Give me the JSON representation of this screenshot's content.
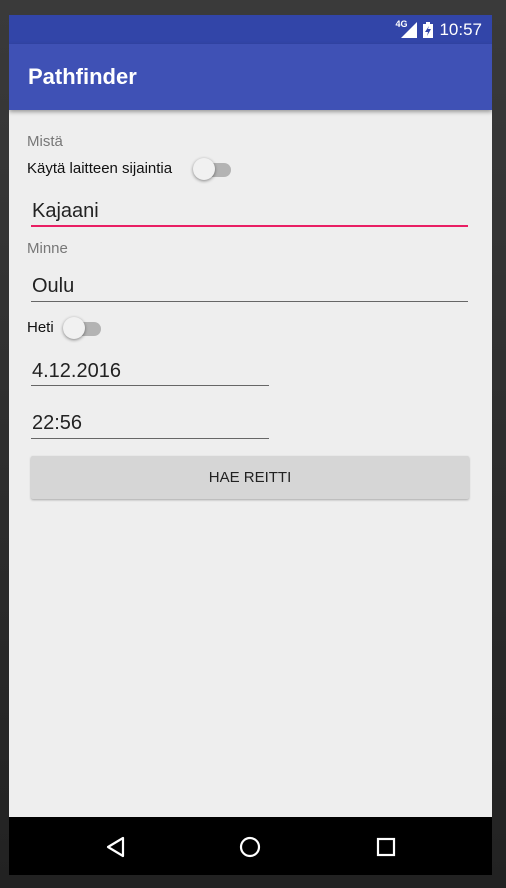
{
  "status_bar": {
    "network": "4G",
    "time": "10:57"
  },
  "app_bar": {
    "title": "Pathfinder"
  },
  "form": {
    "from_label": "Mistä",
    "use_location_label": "Käytä laitteen sijaintia",
    "use_location_on": false,
    "from_value": "Kajaani",
    "to_label": "Minne",
    "to_value": "Oulu",
    "now_label": "Heti",
    "now_on": false,
    "date_value": "4.12.2016",
    "time_value": "22:56",
    "search_button": "HAE REITTI"
  },
  "nav_bar": {
    "back_icon": "back-triangle-icon",
    "home_icon": "home-circle-icon",
    "recents_icon": "recents-square-icon"
  },
  "colors": {
    "status_bar": "#3245a8",
    "app_bar": "#3f51b5",
    "accent": "#e91e63",
    "background": "#eeeeee"
  }
}
